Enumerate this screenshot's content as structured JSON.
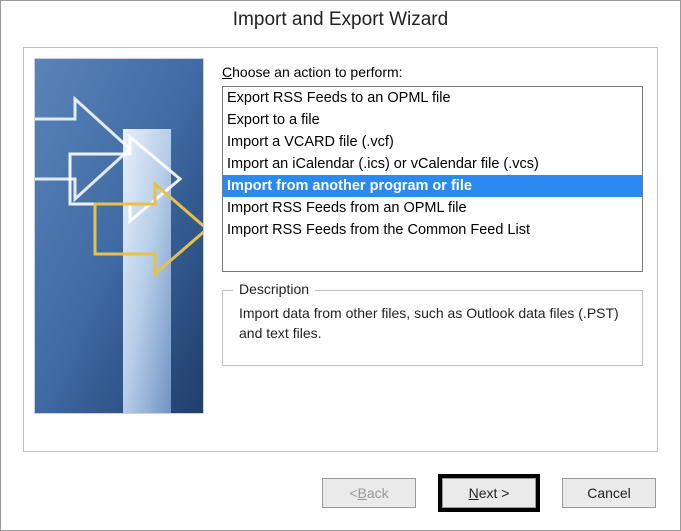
{
  "title": "Import and Export Wizard",
  "label": {
    "prefix_u": "C",
    "rest": "hoose an action to perform:"
  },
  "actions": [
    {
      "label": "Export RSS Feeds to an OPML file",
      "selected": false
    },
    {
      "label": "Export to a file",
      "selected": false
    },
    {
      "label": "Import a VCARD file (.vcf)",
      "selected": false
    },
    {
      "label": "Import an iCalendar (.ics) or vCalendar file (.vcs)",
      "selected": false
    },
    {
      "label": "Import from another program or file",
      "selected": true
    },
    {
      "label": "Import RSS Feeds from an OPML file",
      "selected": false
    },
    {
      "label": "Import RSS Feeds from the Common Feed List",
      "selected": false
    }
  ],
  "description": {
    "legend": "Description",
    "text": "Import data from other files, such as Outlook data files (.PST) and text files."
  },
  "buttons": {
    "back_prefix": "< ",
    "back_u": "B",
    "back_rest": "ack",
    "next_u": "N",
    "next_rest": "ext >",
    "cancel": "Cancel"
  }
}
